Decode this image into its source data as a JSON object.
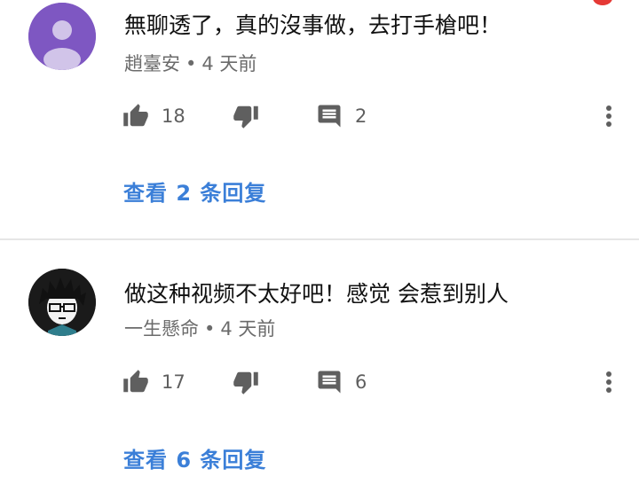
{
  "colors": {
    "accent": "#3b7fd8",
    "text": "#111111",
    "meta": "#6b6b6b",
    "icon": "#5f5f5f",
    "divider": "#e6e6e6",
    "notification": "#e53935"
  },
  "comments": [
    {
      "avatar_icon": "default-user-avatar",
      "text": "無聊透了，真的沒事做，去打手槍吧！",
      "author": "趙臺安",
      "separator": "•",
      "time": "4 天前",
      "likes": "18",
      "replies": "2",
      "view_replies": "查看 2 条回复"
    },
    {
      "avatar_icon": "cartoon-boy-with-glasses-avatar",
      "text": "做这种视频不太好吧！感觉 会惹到别人",
      "author": "一生懸命",
      "separator": "•",
      "time": "4 天前",
      "likes": "17",
      "replies": "6",
      "view_replies": "查看 6 条回复"
    }
  ]
}
